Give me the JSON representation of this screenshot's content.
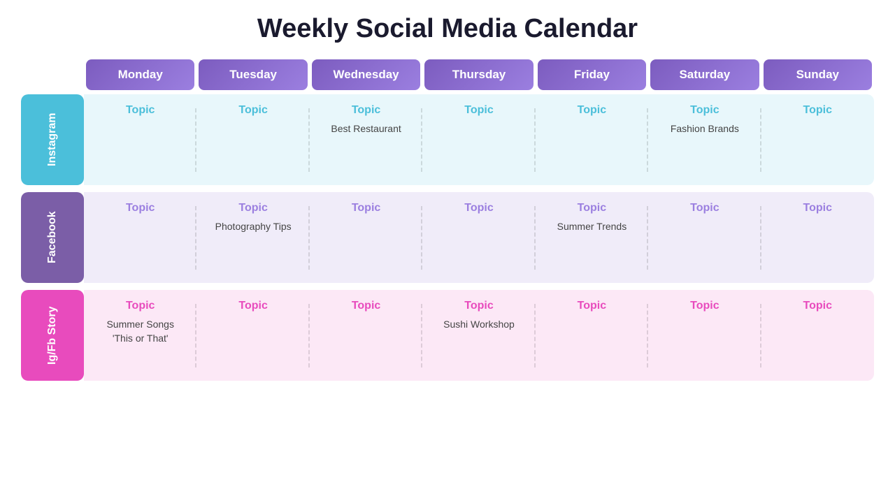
{
  "title": "Weekly Social Media Calendar",
  "days": [
    "Monday",
    "Tuesday",
    "Wednesday",
    "Thursday",
    "Friday",
    "Saturday",
    "Sunday"
  ],
  "sections": [
    {
      "id": "instagram",
      "label": "Instagram",
      "labelClass": "instagram-label",
      "rowClass": "instagram-row",
      "topicColor": "instagram",
      "cells": [
        {
          "topic": "Topic",
          "content": ""
        },
        {
          "topic": "Topic",
          "content": ""
        },
        {
          "topic": "Topic",
          "content": "Best Restaurant"
        },
        {
          "topic": "Topic",
          "content": ""
        },
        {
          "topic": "Topic",
          "content": ""
        },
        {
          "topic": "Topic",
          "content": "Fashion Brands"
        },
        {
          "topic": "Topic",
          "content": ""
        }
      ]
    },
    {
      "id": "facebook",
      "label": "Facebook",
      "labelClass": "facebook-label",
      "rowClass": "facebook-row",
      "topicColor": "facebook",
      "cells": [
        {
          "topic": "Topic",
          "content": ""
        },
        {
          "topic": "Topic",
          "content": "Photography Tips"
        },
        {
          "topic": "Topic",
          "content": ""
        },
        {
          "topic": "Topic",
          "content": ""
        },
        {
          "topic": "Topic",
          "content": "Summer Trends"
        },
        {
          "topic": "Topic",
          "content": ""
        },
        {
          "topic": "Topic",
          "content": ""
        }
      ]
    },
    {
      "id": "igfb",
      "label": "Ig/Fb Story",
      "labelClass": "igfb-label",
      "rowClass": "igfb-row",
      "topicColor": "igfb",
      "cells": [
        {
          "topic": "Topic",
          "content": "Summer Songs\n'This or That'"
        },
        {
          "topic": "Topic",
          "content": ""
        },
        {
          "topic": "Topic",
          "content": ""
        },
        {
          "topic": "Topic",
          "content": "Sushi Workshop"
        },
        {
          "topic": "Topic",
          "content": ""
        },
        {
          "topic": "Topic",
          "content": ""
        },
        {
          "topic": "Topic",
          "content": ""
        }
      ]
    }
  ]
}
